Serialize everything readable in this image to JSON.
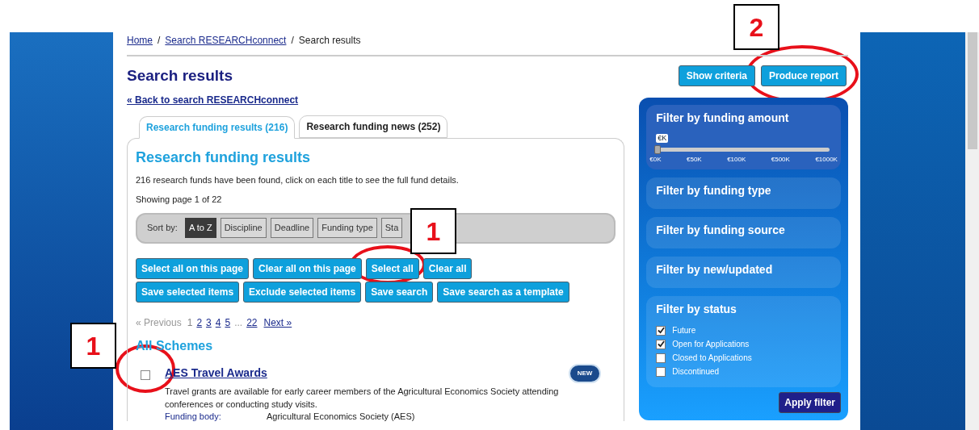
{
  "breadcrumb": [
    {
      "kind": "link",
      "label": "Home"
    },
    {
      "kind": "separator",
      "label": "/"
    },
    {
      "kind": "link",
      "label": "Search RESEARCHconnect"
    },
    {
      "kind": "separator",
      "label": "/"
    },
    {
      "kind": "current",
      "label": "Search results"
    }
  ],
  "title": "Search results",
  "back_link": "« Back to search RESEARCHconnect",
  "header_buttons": [
    "Show criteria",
    "Produce report"
  ],
  "tabs": [
    {
      "label": "Research funding results (216)",
      "selected": true
    },
    {
      "label": "Research funding news (252)",
      "selected": false
    }
  ],
  "results": {
    "heading": "Research funding results",
    "summary": "216 research funds have been found, click on each title to see the full fund details.",
    "page_info": "Showing page 1 of 22",
    "sort_label": "Sort by:",
    "sort_options": [
      {
        "label": "A to Z",
        "selected": true
      },
      {
        "label": "Discipline",
        "selected": false
      },
      {
        "label": "Deadline",
        "selected": false
      },
      {
        "label": "Funding type",
        "selected": false
      },
      {
        "label": "Sta",
        "selected": false
      }
    ],
    "action_rows": [
      [
        "Select all on this page",
        "Clear all on this page",
        "Select all",
        "Clear all"
      ],
      [
        "Save selected items",
        "Exclude selected items",
        "Save search",
        "Save search as a template"
      ]
    ],
    "pagination": [
      {
        "kind": "prev",
        "label": "« Previous"
      },
      {
        "kind": "page",
        "label": "1",
        "selected": true
      },
      {
        "kind": "page",
        "label": "2",
        "selected": false
      },
      {
        "kind": "page",
        "label": "3",
        "selected": false
      },
      {
        "kind": "page",
        "label": "4",
        "selected": false
      },
      {
        "kind": "page",
        "label": "5",
        "selected": false
      },
      {
        "kind": "gap",
        "label": "..."
      },
      {
        "kind": "page",
        "label": "22",
        "selected": false
      },
      {
        "kind": "next",
        "label": "Next »"
      }
    ],
    "section": "All Schemes",
    "items": [
      {
        "checked": false,
        "title": "AES Travel Awards",
        "badge": "NEW",
        "description": "Travel grants are available for early career members of the Agricultural Economics Society attending conferences or conducting study visits.",
        "fields": [
          {
            "label": "Funding body:",
            "value": "Agricultural Economics Society (AES)"
          }
        ]
      }
    ]
  },
  "filters": [
    {
      "kind": "slider",
      "title": "Filter by funding amount",
      "unit": "€K",
      "level": 0,
      "ticks": [
        "€0K",
        "€50K",
        "€100K",
        "€500K",
        "€1000K"
      ]
    },
    {
      "kind": "collapsed",
      "title": "Filter by funding type"
    },
    {
      "kind": "collapsed",
      "title": "Filter by funding source"
    },
    {
      "kind": "collapsed",
      "title": "Filter by new/updated"
    },
    {
      "kind": "checklist",
      "title": "Filter by status",
      "options": [
        {
          "label": "Future",
          "checked": true
        },
        {
          "label": "Open for Applications",
          "checked": true
        },
        {
          "label": "Closed to Applications",
          "checked": false
        },
        {
          "label": "Discontinued",
          "checked": false
        }
      ]
    }
  ],
  "apply_button": "Apply filter",
  "annotations": [
    {
      "label": "2"
    },
    {
      "label": "1"
    },
    {
      "label": "1"
    }
  ]
}
